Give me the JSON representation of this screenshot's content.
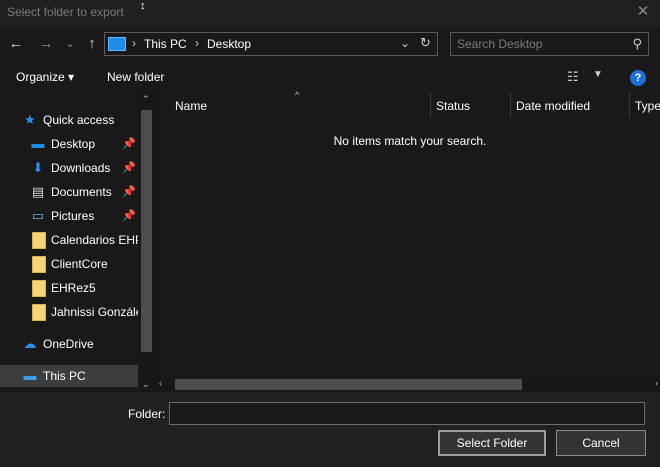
{
  "window": {
    "title": "Select folder to export",
    "close_glyph": "✕",
    "cursor_glyph": "↕"
  },
  "nav": {
    "back_glyph": "←",
    "forward_glyph": "→",
    "recent_glyph": "⌄",
    "up_glyph": "↑",
    "breadcrumb": [
      "This PC",
      "Desktop"
    ],
    "crumb_sep": "›",
    "dropdown_glyph": "⌄",
    "refresh_glyph": "↻",
    "search_placeholder": "Search Desktop",
    "search_icon_glyph": "⚲"
  },
  "toolbar": {
    "organize_label": "Organize ▾",
    "new_folder_label": "New folder",
    "view_glyph": "☷",
    "view_drop_glyph": "▼",
    "help_glyph": "?"
  },
  "sidebar": {
    "items": [
      {
        "label": "Quick access",
        "icon": "star-icon",
        "glyph": "★",
        "color": "#2f8ff0"
      },
      {
        "label": "Desktop",
        "icon": "desktop-icon",
        "glyph": "▬",
        "color": "#1e8ee6",
        "pinned": true
      },
      {
        "label": "Downloads",
        "icon": "download-arrow-icon",
        "glyph": "⬇",
        "color": "#2f8ff0",
        "pinned": true
      },
      {
        "label": "Documents",
        "icon": "document-icon",
        "glyph": "▤",
        "color": "#d8d8d8",
        "pinned": true
      },
      {
        "label": "Pictures",
        "icon": "pictures-icon",
        "glyph": "▭",
        "color": "#6fb3e8",
        "pinned": true
      },
      {
        "label": "Calendarios EHP",
        "icon": "folder-icon"
      },
      {
        "label": "ClientCore",
        "icon": "folder-icon"
      },
      {
        "label": "EHRez5",
        "icon": "folder-icon"
      },
      {
        "label": "Jahnissi González",
        "icon": "folder-icon"
      },
      {
        "label": "OneDrive",
        "icon": "cloud-icon",
        "glyph": "☁",
        "color": "#2f8ff0"
      },
      {
        "label": "This PC",
        "icon": "computer-icon",
        "glyph": "▬",
        "color": "#3da0e8",
        "selected": true
      }
    ],
    "pin_glyph": "📌",
    "scroll_up_glyph": "⌃",
    "scroll_down_glyph": "⌄"
  },
  "file_list": {
    "columns": [
      "Name",
      "Status",
      "Date modified",
      "Type"
    ],
    "sort_glyph": "^",
    "empty_message": "No items match your search.",
    "scroll_left_glyph": "‹",
    "scroll_right_glyph": "›"
  },
  "footer": {
    "folder_label": "Folder:",
    "folder_value": "",
    "select_button": "Select Folder",
    "cancel_button": "Cancel"
  }
}
